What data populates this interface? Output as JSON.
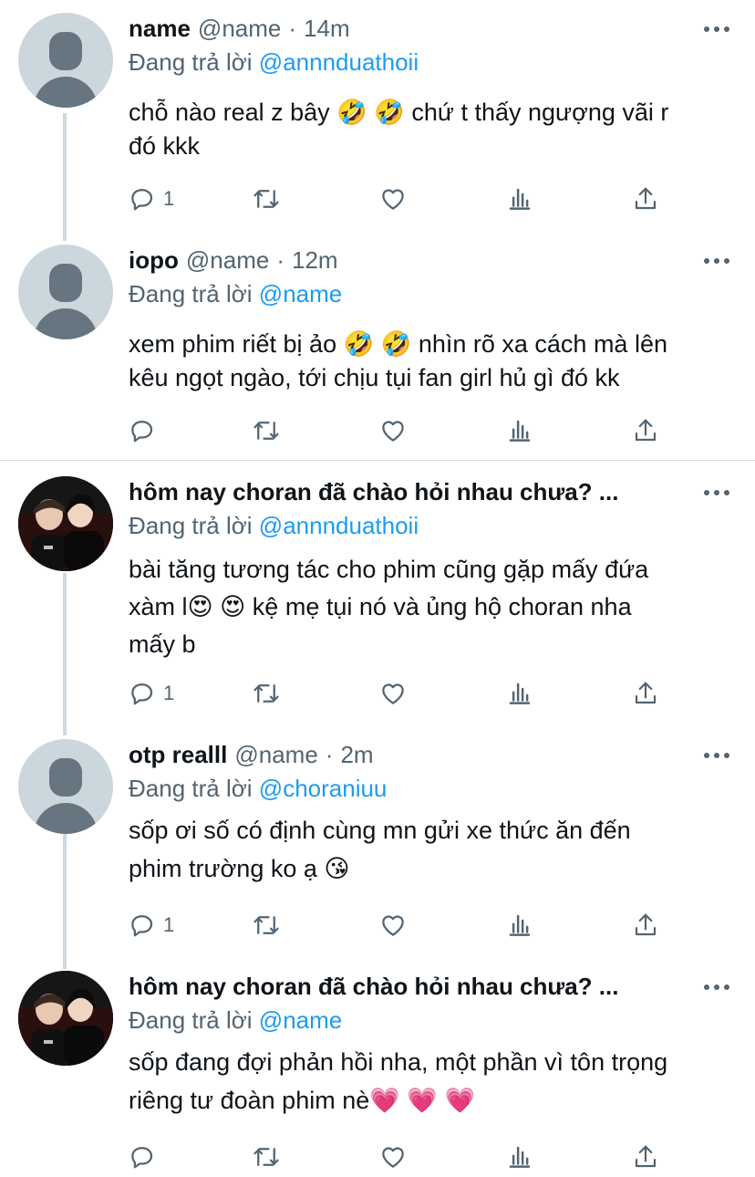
{
  "colors": {
    "text": "#0f1419",
    "secondary": "#536471",
    "link": "#1d9bf0",
    "line": "#cfd9de",
    "avatar_bg": "#ccd6dd"
  },
  "tweets": [
    {
      "name": "name",
      "handle": "@name",
      "dot": "·",
      "time": "14m",
      "reply_prefix": "Đang trả lời",
      "reply_to": "@annnduathoii",
      "text_lines": [
        "chỗ nào real z bây 🤣 🤣  chứ t thấy ngượng vãi r",
        "đó kkk"
      ],
      "reply_count": "1",
      "avatar": "default-avatar"
    },
    {
      "name": "iopo",
      "handle": "@name",
      "dot": "·",
      "time": "12m",
      "reply_prefix": "Đang trả lời",
      "reply_to": "@name",
      "text_lines": [
        "xem phim riết bị ảo 🤣 🤣  nhìn rõ xa cách mà lên",
        "kêu ngọt ngào, tới chịu tụi fan girl hủ gì đó kk"
      ],
      "reply_count": "",
      "avatar": "default-avatar"
    },
    {
      "name": "hôm nay choran đã chào hỏi nhau chưa? ...",
      "handle": "",
      "dot": "",
      "time": "",
      "reply_prefix": "Đang trả lời",
      "reply_to": "@annnduathoii",
      "text_lines": [
        "bài tăng tương tác cho phim cũng gặp mấy đứa",
        "xàm l😍 😍  kệ mẹ tụi nó và ủng hộ choran nha",
        "mấy b"
      ],
      "reply_count": "1",
      "avatar": "photo-avatar"
    },
    {
      "name": "otp realll",
      "handle": "@name",
      "dot": "·",
      "time": "2m",
      "reply_prefix": "Đang trả lời",
      "reply_to": "@choraniuu",
      "text_lines": [
        "sốp ơi số có định cùng mn gửi xe thức ăn đến",
        "phim trường ko ạ 😘"
      ],
      "reply_count": "1",
      "avatar": "default-avatar"
    },
    {
      "name": "hôm nay choran đã chào hỏi nhau chưa? ...",
      "handle": "",
      "dot": "",
      "time": "",
      "reply_prefix": "Đang trả lời",
      "reply_to": "@name",
      "text_lines": [
        "sốp đang đợi phản hồi nha, một phần vì tôn trọng",
        "riêng tư đoàn phim nè💗 💗 💗"
      ],
      "reply_count": "",
      "avatar": "photo-avatar"
    }
  ]
}
